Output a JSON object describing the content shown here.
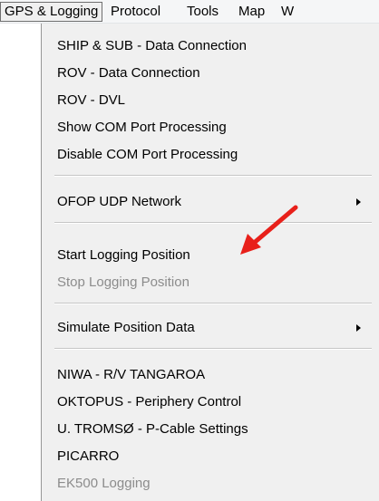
{
  "menubar": {
    "items": [
      {
        "label": "GPS & Logging"
      },
      {
        "label": "Protocol"
      },
      {
        "label": "Tools"
      },
      {
        "label": "Map"
      },
      {
        "label": "W"
      }
    ]
  },
  "dropdown": {
    "items": [
      {
        "label": "SHIP & SUB - Data Connection",
        "enabled": true
      },
      {
        "label": "ROV - Data Connection",
        "enabled": true
      },
      {
        "label": "ROV - DVL",
        "enabled": true
      },
      {
        "label": "Show COM Port Processing",
        "enabled": true
      },
      {
        "label": "Disable COM Port Processing",
        "enabled": true
      },
      {
        "label": "OFOP UDP Network",
        "enabled": true,
        "submenu": true
      },
      {
        "label": "Start Logging Position",
        "enabled": true
      },
      {
        "label": "Stop Logging Position",
        "enabled": false
      },
      {
        "label": "Simulate Position Data",
        "enabled": true,
        "submenu": true
      },
      {
        "label": "NIWA - R/V TANGAROA",
        "enabled": true
      },
      {
        "label": "OKTOPUS - Periphery Control",
        "enabled": true
      },
      {
        "label": "U. TROMSØ - P-Cable Settings",
        "enabled": true
      },
      {
        "label": "PICARRO",
        "enabled": true
      },
      {
        "label": "EK500 Logging",
        "enabled": false
      }
    ]
  },
  "annotation": {
    "color": "#e8201a",
    "icon": "red-pointer-arrow"
  },
  "colors": {
    "menu_background": "#f0f0f0",
    "disabled_text": "#8c8c8c",
    "active_border": "#6f6f6f"
  }
}
